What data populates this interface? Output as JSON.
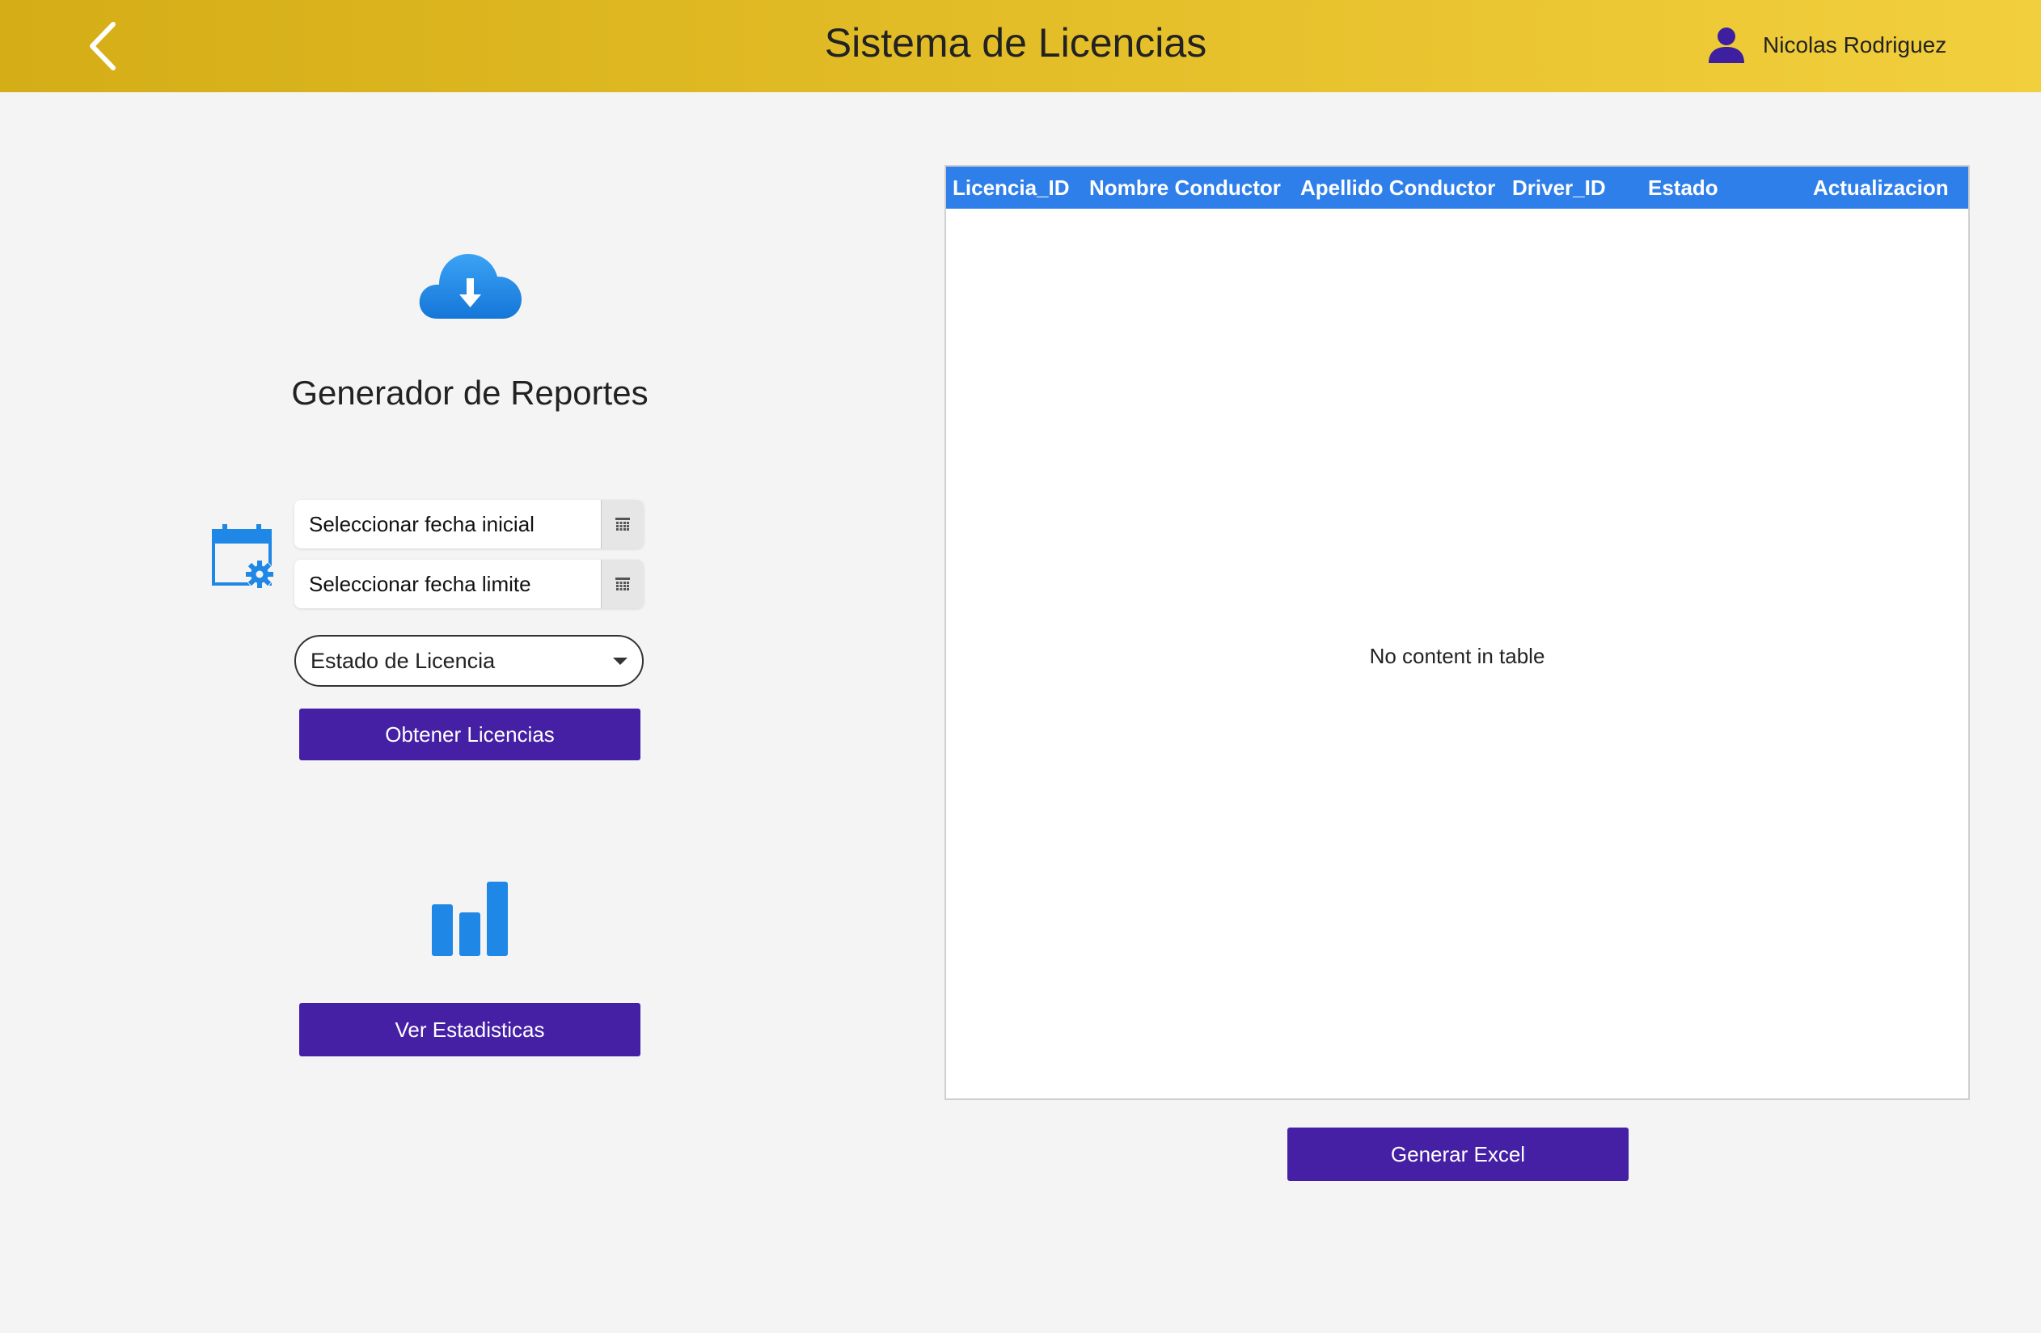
{
  "header": {
    "title": "Sistema de Licencias",
    "user_name": "Nicolas Rodriguez",
    "back_icon": "chevron-left-icon",
    "user_icon": "user-icon"
  },
  "report": {
    "title": "Generador de Reportes",
    "cloud_icon": "cloud-download-icon",
    "calendar_icon": "calendar-settings-icon",
    "start_date_placeholder": "Seleccionar fecha inicial",
    "end_date_placeholder": "Seleccionar fecha limite",
    "status_select_value": "Estado de Licencia",
    "get_licenses_label": "Obtener Licencias",
    "stats_icon": "bar-chart-icon",
    "view_stats_label": "Ver Estadisticas"
  },
  "table": {
    "columns": [
      "Licencia_ID",
      "Nombre Conductor",
      "Apellido Conductor",
      "Driver_ID",
      "Estado",
      "Actualizacion"
    ],
    "rows": [],
    "empty_message": "No content in table"
  },
  "actions": {
    "generate_excel_label": "Generar Excel"
  },
  "colors": {
    "header_gradient_start": "#d4ad17",
    "header_gradient_end": "#f2cf3d",
    "primary_button": "#4520a5",
    "table_header": "#2f7fea",
    "icon_blue": "#1f87e5",
    "user_icon": "#3d1fa0"
  }
}
